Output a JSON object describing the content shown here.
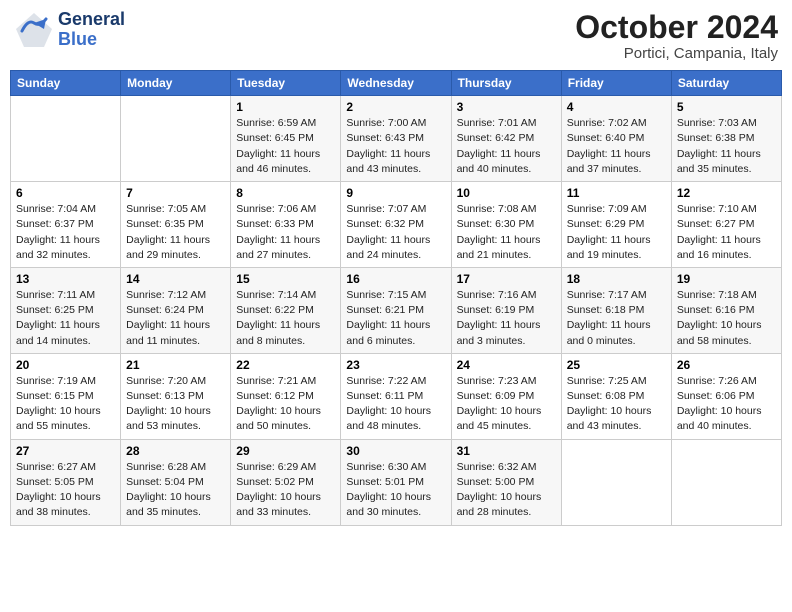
{
  "header": {
    "logo_general": "General",
    "logo_blue": "Blue",
    "month_title": "October 2024",
    "location": "Portici, Campania, Italy"
  },
  "days_of_week": [
    "Sunday",
    "Monday",
    "Tuesday",
    "Wednesday",
    "Thursday",
    "Friday",
    "Saturday"
  ],
  "weeks": [
    [
      {
        "day": "",
        "sunrise": "",
        "sunset": "",
        "daylight": ""
      },
      {
        "day": "",
        "sunrise": "",
        "sunset": "",
        "daylight": ""
      },
      {
        "day": "1",
        "sunrise": "Sunrise: 6:59 AM",
        "sunset": "Sunset: 6:45 PM",
        "daylight": "Daylight: 11 hours and 46 minutes."
      },
      {
        "day": "2",
        "sunrise": "Sunrise: 7:00 AM",
        "sunset": "Sunset: 6:43 PM",
        "daylight": "Daylight: 11 hours and 43 minutes."
      },
      {
        "day": "3",
        "sunrise": "Sunrise: 7:01 AM",
        "sunset": "Sunset: 6:42 PM",
        "daylight": "Daylight: 11 hours and 40 minutes."
      },
      {
        "day": "4",
        "sunrise": "Sunrise: 7:02 AM",
        "sunset": "Sunset: 6:40 PM",
        "daylight": "Daylight: 11 hours and 37 minutes."
      },
      {
        "day": "5",
        "sunrise": "Sunrise: 7:03 AM",
        "sunset": "Sunset: 6:38 PM",
        "daylight": "Daylight: 11 hours and 35 minutes."
      }
    ],
    [
      {
        "day": "6",
        "sunrise": "Sunrise: 7:04 AM",
        "sunset": "Sunset: 6:37 PM",
        "daylight": "Daylight: 11 hours and 32 minutes."
      },
      {
        "day": "7",
        "sunrise": "Sunrise: 7:05 AM",
        "sunset": "Sunset: 6:35 PM",
        "daylight": "Daylight: 11 hours and 29 minutes."
      },
      {
        "day": "8",
        "sunrise": "Sunrise: 7:06 AM",
        "sunset": "Sunset: 6:33 PM",
        "daylight": "Daylight: 11 hours and 27 minutes."
      },
      {
        "day": "9",
        "sunrise": "Sunrise: 7:07 AM",
        "sunset": "Sunset: 6:32 PM",
        "daylight": "Daylight: 11 hours and 24 minutes."
      },
      {
        "day": "10",
        "sunrise": "Sunrise: 7:08 AM",
        "sunset": "Sunset: 6:30 PM",
        "daylight": "Daylight: 11 hours and 21 minutes."
      },
      {
        "day": "11",
        "sunrise": "Sunrise: 7:09 AM",
        "sunset": "Sunset: 6:29 PM",
        "daylight": "Daylight: 11 hours and 19 minutes."
      },
      {
        "day": "12",
        "sunrise": "Sunrise: 7:10 AM",
        "sunset": "Sunset: 6:27 PM",
        "daylight": "Daylight: 11 hours and 16 minutes."
      }
    ],
    [
      {
        "day": "13",
        "sunrise": "Sunrise: 7:11 AM",
        "sunset": "Sunset: 6:25 PM",
        "daylight": "Daylight: 11 hours and 14 minutes."
      },
      {
        "day": "14",
        "sunrise": "Sunrise: 7:12 AM",
        "sunset": "Sunset: 6:24 PM",
        "daylight": "Daylight: 11 hours and 11 minutes."
      },
      {
        "day": "15",
        "sunrise": "Sunrise: 7:14 AM",
        "sunset": "Sunset: 6:22 PM",
        "daylight": "Daylight: 11 hours and 8 minutes."
      },
      {
        "day": "16",
        "sunrise": "Sunrise: 7:15 AM",
        "sunset": "Sunset: 6:21 PM",
        "daylight": "Daylight: 11 hours and 6 minutes."
      },
      {
        "day": "17",
        "sunrise": "Sunrise: 7:16 AM",
        "sunset": "Sunset: 6:19 PM",
        "daylight": "Daylight: 11 hours and 3 minutes."
      },
      {
        "day": "18",
        "sunrise": "Sunrise: 7:17 AM",
        "sunset": "Sunset: 6:18 PM",
        "daylight": "Daylight: 11 hours and 0 minutes."
      },
      {
        "day": "19",
        "sunrise": "Sunrise: 7:18 AM",
        "sunset": "Sunset: 6:16 PM",
        "daylight": "Daylight: 10 hours and 58 minutes."
      }
    ],
    [
      {
        "day": "20",
        "sunrise": "Sunrise: 7:19 AM",
        "sunset": "Sunset: 6:15 PM",
        "daylight": "Daylight: 10 hours and 55 minutes."
      },
      {
        "day": "21",
        "sunrise": "Sunrise: 7:20 AM",
        "sunset": "Sunset: 6:13 PM",
        "daylight": "Daylight: 10 hours and 53 minutes."
      },
      {
        "day": "22",
        "sunrise": "Sunrise: 7:21 AM",
        "sunset": "Sunset: 6:12 PM",
        "daylight": "Daylight: 10 hours and 50 minutes."
      },
      {
        "day": "23",
        "sunrise": "Sunrise: 7:22 AM",
        "sunset": "Sunset: 6:11 PM",
        "daylight": "Daylight: 10 hours and 48 minutes."
      },
      {
        "day": "24",
        "sunrise": "Sunrise: 7:23 AM",
        "sunset": "Sunset: 6:09 PM",
        "daylight": "Daylight: 10 hours and 45 minutes."
      },
      {
        "day": "25",
        "sunrise": "Sunrise: 7:25 AM",
        "sunset": "Sunset: 6:08 PM",
        "daylight": "Daylight: 10 hours and 43 minutes."
      },
      {
        "day": "26",
        "sunrise": "Sunrise: 7:26 AM",
        "sunset": "Sunset: 6:06 PM",
        "daylight": "Daylight: 10 hours and 40 minutes."
      }
    ],
    [
      {
        "day": "27",
        "sunrise": "Sunrise: 6:27 AM",
        "sunset": "Sunset: 5:05 PM",
        "daylight": "Daylight: 10 hours and 38 minutes."
      },
      {
        "day": "28",
        "sunrise": "Sunrise: 6:28 AM",
        "sunset": "Sunset: 5:04 PM",
        "daylight": "Daylight: 10 hours and 35 minutes."
      },
      {
        "day": "29",
        "sunrise": "Sunrise: 6:29 AM",
        "sunset": "Sunset: 5:02 PM",
        "daylight": "Daylight: 10 hours and 33 minutes."
      },
      {
        "day": "30",
        "sunrise": "Sunrise: 6:30 AM",
        "sunset": "Sunset: 5:01 PM",
        "daylight": "Daylight: 10 hours and 30 minutes."
      },
      {
        "day": "31",
        "sunrise": "Sunrise: 6:32 AM",
        "sunset": "Sunset: 5:00 PM",
        "daylight": "Daylight: 10 hours and 28 minutes."
      },
      {
        "day": "",
        "sunrise": "",
        "sunset": "",
        "daylight": ""
      },
      {
        "day": "",
        "sunrise": "",
        "sunset": "",
        "daylight": ""
      }
    ]
  ]
}
